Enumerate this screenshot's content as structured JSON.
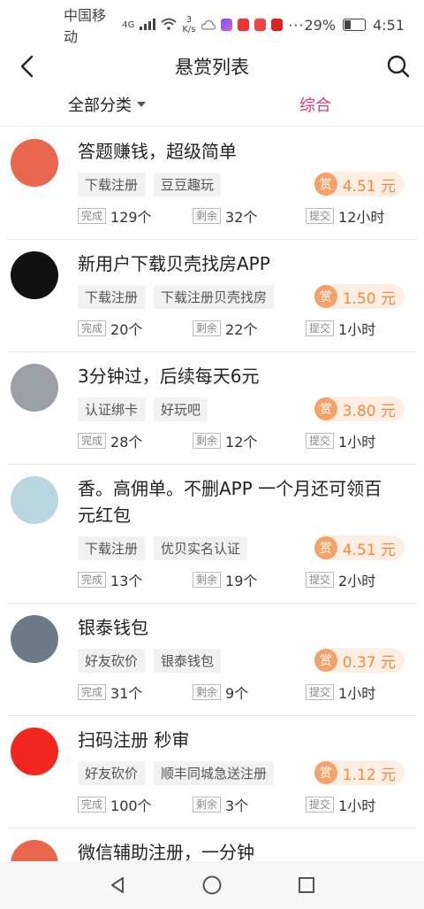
{
  "status_bar": {
    "carrier": "中国移动",
    "signal": "4G",
    "speed_value": "3",
    "speed_unit": "K/s",
    "battery": "29%",
    "time": "4:51"
  },
  "header": {
    "title": "悬赏列表"
  },
  "filters": {
    "category": "全部分类",
    "sort": "综合"
  },
  "labels": {
    "reward": "赏",
    "done": "完成",
    "remain": "剩余",
    "submit": "提交"
  },
  "items": [
    {
      "title": "答题赚钱，超级简单",
      "tags": [
        "下载注册",
        "豆豆趣玩"
      ],
      "amount": "4.51 元",
      "done": "129个",
      "remain": "32个",
      "submit": "12小时",
      "avatar_color": "#e8674e"
    },
    {
      "title": "新用户下载贝壳找房APP",
      "tags": [
        "下载注册",
        "下载注册贝壳找房"
      ],
      "amount": "1.50 元",
      "done": "20个",
      "remain": "22个",
      "submit": "1小时",
      "avatar_color": "#111111"
    },
    {
      "title": "3分钟过，后续每天6元",
      "tags": [
        "认证绑卡",
        "好玩吧"
      ],
      "amount": "3.80 元",
      "done": "28个",
      "remain": "12个",
      "submit": "1小时",
      "avatar_color": "#9aa0a6"
    },
    {
      "title": "香。高佣单。不删APP 一个月还可领百元红包",
      "tags": [
        "下载注册",
        "优贝实名认证"
      ],
      "amount": "4.51 元",
      "done": "13个",
      "remain": "19个",
      "submit": "2小时",
      "avatar_color": "#b9d6e0"
    },
    {
      "title": "银泰钱包",
      "tags": [
        "好友砍价",
        "银泰钱包"
      ],
      "amount": "0.37 元",
      "done": "31个",
      "remain": "9个",
      "submit": "1小时",
      "avatar_color": "#6b7a86"
    },
    {
      "title": "扫码注册 秒审",
      "tags": [
        "好友砍价",
        "顺丰同城急送注册"
      ],
      "amount": "1.12 元",
      "done": "100个",
      "remain": "3个",
      "submit": "1小时",
      "avatar_color": "#f0261f"
    },
    {
      "title": "微信辅助注册，一分钟",
      "tags": [],
      "amount": "",
      "done": "",
      "remain": "",
      "submit": "",
      "avatar_color": "#e8674e"
    }
  ],
  "colors": {
    "accent": "#d63a7a",
    "reward_bg": "#fdeee4",
    "reward_text": "#f08a3f",
    "reward_badge": "#f5a26a"
  }
}
